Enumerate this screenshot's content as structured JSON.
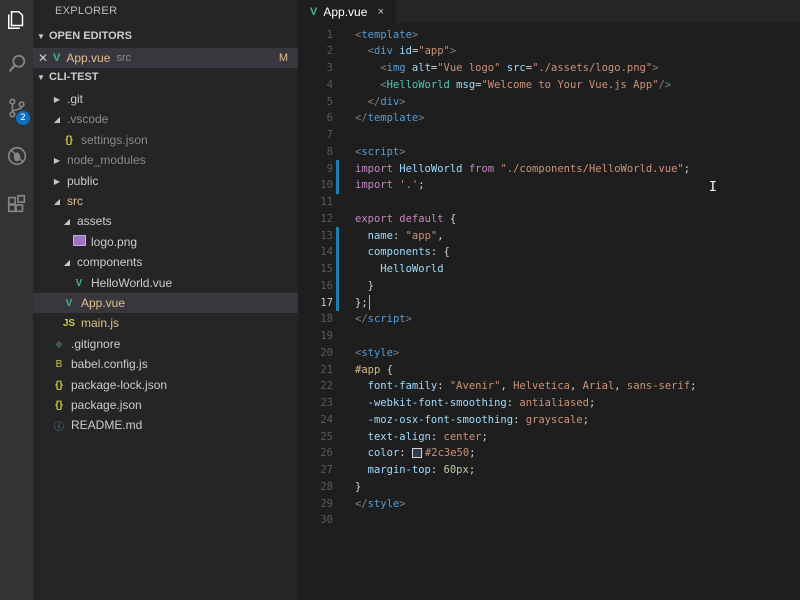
{
  "activity": {
    "items": [
      "files-icon",
      "search-icon",
      "source-control-icon",
      "debug-icon",
      "extensions-icon"
    ],
    "scm_badge": "2"
  },
  "sidebar": {
    "title": "EXPLORER",
    "open_editors": {
      "header": "OPEN EDITORS",
      "items": [
        {
          "name": "App.vue",
          "folder": "src",
          "status": "M"
        }
      ]
    },
    "project": {
      "header": "CLI-TEST",
      "tree": [
        {
          "label": ".git",
          "type": "folder",
          "collapsed": true
        },
        {
          "label": ".vscode",
          "type": "folder",
          "expanded": true
        },
        {
          "label": "settings.json",
          "type": "json"
        },
        {
          "label": "node_modules",
          "type": "folder",
          "collapsed": true
        },
        {
          "label": "public",
          "type": "folder",
          "collapsed": true
        },
        {
          "label": "src",
          "type": "folder",
          "expanded": true
        },
        {
          "label": "assets",
          "type": "folder",
          "expanded": true
        },
        {
          "label": "logo.png",
          "type": "image"
        },
        {
          "label": "components",
          "type": "folder",
          "expanded": true
        },
        {
          "label": "HelloWorld.vue",
          "type": "vue"
        },
        {
          "label": "App.vue",
          "type": "vue",
          "status": "M"
        },
        {
          "label": "main.js",
          "type": "js",
          "status": "M"
        },
        {
          "label": ".gitignore",
          "type": "git"
        },
        {
          "label": "babel.config.js",
          "type": "babel"
        },
        {
          "label": "package-lock.json",
          "type": "json"
        },
        {
          "label": "package.json",
          "type": "json"
        },
        {
          "label": "README.md",
          "type": "info"
        }
      ]
    }
  },
  "editor": {
    "tab": {
      "label": "App.vue",
      "close": "×"
    },
    "line_numbers": [
      "1",
      "2",
      "3",
      "4",
      "5",
      "6",
      "7",
      "8",
      "9",
      "10",
      "11",
      "12",
      "13",
      "14",
      "15",
      "16",
      "17",
      "18",
      "19",
      "20",
      "21",
      "22",
      "23",
      "24",
      "25",
      "26",
      "27",
      "28",
      "29",
      "30"
    ],
    "lines": [
      [
        [
          "t-tag",
          "<"
        ],
        [
          "t-name",
          "template"
        ],
        [
          "t-tag",
          ">"
        ]
      ],
      [
        [
          "t-plain",
          "  "
        ],
        [
          "t-tag",
          "<"
        ],
        [
          "t-name",
          "div"
        ],
        [
          "t-plain",
          " "
        ],
        [
          "t-attr",
          "id"
        ],
        [
          "t-plain",
          "="
        ],
        [
          "t-str",
          "\"app\""
        ],
        [
          "t-tag",
          ">"
        ]
      ],
      [
        [
          "t-plain",
          "    "
        ],
        [
          "t-tag",
          "<"
        ],
        [
          "t-name",
          "img"
        ],
        [
          "t-plain",
          " "
        ],
        [
          "t-attr",
          "alt"
        ],
        [
          "t-plain",
          "="
        ],
        [
          "t-str",
          "\"Vue logo\""
        ],
        [
          "t-plain",
          " "
        ],
        [
          "t-attr",
          "src"
        ],
        [
          "t-plain",
          "="
        ],
        [
          "t-str",
          "\"./assets/logo.png\""
        ],
        [
          "t-tag",
          ">"
        ]
      ],
      [
        [
          "t-plain",
          "    "
        ],
        [
          "t-tag",
          "<"
        ],
        [
          "t-cls",
          "HelloWorld"
        ],
        [
          "t-plain",
          " "
        ],
        [
          "t-attr",
          "msg"
        ],
        [
          "t-plain",
          "="
        ],
        [
          "t-str",
          "\"Welcome to Your Vue.js App\""
        ],
        [
          "t-tag",
          "/>"
        ]
      ],
      [
        [
          "t-plain",
          "  "
        ],
        [
          "t-tag",
          "</"
        ],
        [
          "t-name",
          "div"
        ],
        [
          "t-tag",
          ">"
        ]
      ],
      [
        [
          "t-tag",
          "</"
        ],
        [
          "t-name",
          "template"
        ],
        [
          "t-tag",
          ">"
        ]
      ],
      [],
      [
        [
          "t-tag",
          "<"
        ],
        [
          "t-name",
          "script"
        ],
        [
          "t-tag",
          ">"
        ]
      ],
      [
        [
          "t-kw",
          "import"
        ],
        [
          "t-plain",
          " "
        ],
        [
          "t-var",
          "HelloWorld"
        ],
        [
          "t-plain",
          " "
        ],
        [
          "t-kw",
          "from"
        ],
        [
          "t-plain",
          " "
        ],
        [
          "t-str",
          "\"./components/HelloWorld.vue\""
        ],
        [
          "t-plain",
          ";"
        ]
      ],
      [
        [
          "t-kw",
          "import"
        ],
        [
          "t-plain",
          " "
        ],
        [
          "t-str",
          "'.'"
        ],
        [
          "t-plain",
          ";"
        ]
      ],
      [],
      [
        [
          "t-kw",
          "export"
        ],
        [
          "t-plain",
          " "
        ],
        [
          "t-kw",
          "default"
        ],
        [
          "t-plain",
          " {"
        ]
      ],
      [
        [
          "t-plain",
          "  "
        ],
        [
          "t-var",
          "name"
        ],
        [
          "t-plain",
          ": "
        ],
        [
          "t-str",
          "\"app\""
        ],
        [
          "t-plain",
          ","
        ]
      ],
      [
        [
          "t-plain",
          "  "
        ],
        [
          "t-var",
          "components"
        ],
        [
          "t-plain",
          ": {"
        ]
      ],
      [
        [
          "t-plain",
          "    "
        ],
        [
          "t-var",
          "HelloWorld"
        ]
      ],
      [
        [
          "t-plain",
          "  }"
        ]
      ],
      [
        [
          "t-plain",
          "};"
        ]
      ],
      [
        [
          "t-tag",
          "</"
        ],
        [
          "t-name",
          "script"
        ],
        [
          "t-tag",
          ">"
        ]
      ],
      [],
      [
        [
          "t-tag",
          "<"
        ],
        [
          "t-name",
          "style"
        ],
        [
          "t-tag",
          ">"
        ]
      ],
      [
        [
          "t-sel",
          "#app"
        ],
        [
          "t-plain",
          " {"
        ]
      ],
      [
        [
          "t-plain",
          "  "
        ],
        [
          "t-prop",
          "font-family"
        ],
        [
          "t-plain",
          ": "
        ],
        [
          "t-val",
          "\"Avenir\""
        ],
        [
          "t-plain",
          ", "
        ],
        [
          "t-val",
          "Helvetica"
        ],
        [
          "t-plain",
          ", "
        ],
        [
          "t-val",
          "Arial"
        ],
        [
          "t-plain",
          ", "
        ],
        [
          "t-val",
          "sans-serif"
        ],
        [
          "t-plain",
          ";"
        ]
      ],
      [
        [
          "t-plain",
          "  "
        ],
        [
          "t-prop",
          "-webkit-font-smoothing"
        ],
        [
          "t-plain",
          ": "
        ],
        [
          "t-val",
          "antialiased"
        ],
        [
          "t-plain",
          ";"
        ]
      ],
      [
        [
          "t-plain",
          "  "
        ],
        [
          "t-prop",
          "-moz-osx-font-smoothing"
        ],
        [
          "t-plain",
          ": "
        ],
        [
          "t-val",
          "grayscale"
        ],
        [
          "t-plain",
          ";"
        ]
      ],
      [
        [
          "t-plain",
          "  "
        ],
        [
          "t-prop",
          "text-align"
        ],
        [
          "t-plain",
          ": "
        ],
        [
          "t-val",
          "center"
        ],
        [
          "t-plain",
          ";"
        ]
      ],
      [
        [
          "t-plain",
          "  "
        ],
        [
          "t-prop",
          "color"
        ],
        [
          "t-plain",
          ": "
        ],
        [
          "swatch",
          ""
        ],
        [
          "t-val",
          "#2c3e50"
        ],
        [
          "t-plain",
          ";"
        ]
      ],
      [
        [
          "t-plain",
          "  "
        ],
        [
          "t-prop",
          "margin-top"
        ],
        [
          "t-plain",
          ": "
        ],
        [
          "t-num",
          "60px"
        ],
        [
          "t-plain",
          ";"
        ]
      ],
      [
        [
          "t-plain",
          "}"
        ]
      ],
      [
        [
          "t-tag",
          "</"
        ],
        [
          "t-name",
          "style"
        ],
        [
          "t-tag",
          ">"
        ]
      ],
      []
    ],
    "current_line": "17",
    "modified_gutter_lines": [
      "9",
      "10",
      "13",
      "14",
      "15",
      "16",
      "17"
    ]
  }
}
